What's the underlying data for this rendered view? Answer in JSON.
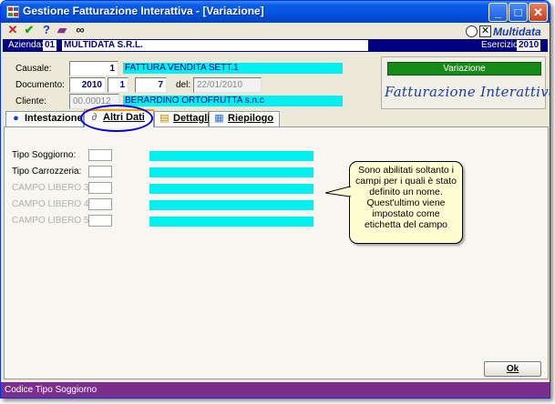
{
  "window": {
    "title": "Gestione Fatturazione Interattiva - [Variazione]"
  },
  "titlebar_buttons": {
    "minimize": "_",
    "maximize": "□",
    "close": "✕"
  },
  "toolbar": {
    "brand": "Multidata",
    "brand_box": "✕",
    "icons": [
      "close-red-icon",
      "check-green-icon",
      "help-icon",
      "book-icon",
      "binoculars-icon"
    ]
  },
  "header": {
    "azienda_label": "Azienda:",
    "azienda_code": "01",
    "azienda_name": "MULTIDATA S.R.L.",
    "esercizio_label": "Esercizio:",
    "esercizio_value": "2010"
  },
  "form": {
    "causale_label": "Causale:",
    "causale_value": "1",
    "causale_desc": "FATTURA VENDITA SETT.1",
    "documento_label": "Documento:",
    "doc_year": "2010",
    "doc_series": "1",
    "doc_number": "7",
    "del_label": "del:",
    "doc_date": "22/01/2010",
    "cliente_label": "Cliente:",
    "cliente_code": "00.00012",
    "cliente_name": "BERARDINO ORTOFRUTTA s.n.c"
  },
  "mode_panel": {
    "mode_label": "Variazione",
    "logo_text": "Fatturazione Interattiva"
  },
  "tabs": [
    {
      "label": "Intestazione",
      "icon": "person-icon"
    },
    {
      "label": "Altri Dati",
      "icon": "paperclip-icon"
    },
    {
      "label": "Dettagli",
      "icon": "list-icon"
    },
    {
      "label": "Riepilogo",
      "icon": "summary-icon"
    }
  ],
  "altri_dati": {
    "rows": [
      {
        "label": "Tipo Soggiorno:",
        "enabled": true
      },
      {
        "label": "Tipo Carrozzeria:",
        "enabled": true
      },
      {
        "label": "CAMPO LIBERO 3.....",
        "enabled": false
      },
      {
        "label": "CAMPO LIBERO 4.....",
        "enabled": false
      },
      {
        "label": "CAMPO LIBERO 5.....",
        "enabled": false
      }
    ]
  },
  "callout_text": "Sono abilitati soltanto i campi per i quali è stato definito un nome. Quest'ultimo viene impostato come etichetta del campo",
  "ok_button": "Ok",
  "status": "Codice Tipo Soggiorno",
  "colors": {
    "cyan": "#00f0f0",
    "navy": "#000080",
    "status_purple": "#7b2e8c",
    "green_mode": "#168a16",
    "callout_oval": "#0000e0"
  }
}
